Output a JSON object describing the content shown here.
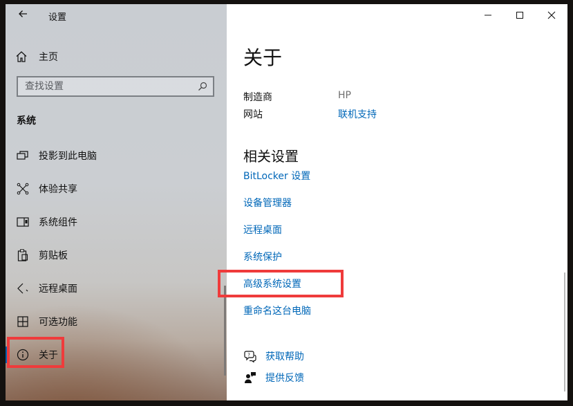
{
  "window": {
    "app_title": "设置",
    "controls": {
      "minimize_icon": "minimize-icon",
      "maximize_icon": "maximize-icon",
      "close_icon": "close-icon"
    }
  },
  "sidebar": {
    "back_icon": "back-arrow-icon",
    "home": {
      "label": "主页",
      "icon": "home-icon"
    },
    "search": {
      "placeholder": "查找设置",
      "value": "",
      "icon": "search-icon"
    },
    "section_title": "系统",
    "items": [
      {
        "label": "投影到此电脑",
        "icon": "projector-icon",
        "active": false
      },
      {
        "label": "体验共享",
        "icon": "share-icon",
        "active": false
      },
      {
        "label": "系统组件",
        "icon": "components-icon",
        "active": false
      },
      {
        "label": "剪贴板",
        "icon": "clipboard-icon",
        "active": false
      },
      {
        "label": "远程桌面",
        "icon": "remote-desktop-icon",
        "active": false
      },
      {
        "label": "可选功能",
        "icon": "grid-icon",
        "active": false
      },
      {
        "label": "关于",
        "icon": "info-icon",
        "active": true
      }
    ]
  },
  "content": {
    "title": "关于",
    "support_info": [
      {
        "key": "制造商",
        "value": "HP",
        "is_link": false
      },
      {
        "key": "网站",
        "value": "联机支持",
        "is_link": true
      }
    ],
    "related_settings": {
      "heading": "相关设置",
      "links": [
        "BitLocker 设置",
        "设备管理器",
        "远程桌面",
        "系统保护",
        "高级系统设置",
        "重命名这台电脑"
      ]
    },
    "help": [
      {
        "label": "获取帮助",
        "icon": "help-chat-icon"
      },
      {
        "label": "提供反馈",
        "icon": "feedback-icon"
      }
    ]
  },
  "colors": {
    "accent": "#0067b8",
    "active_bar": "#0063b1",
    "highlight": "#ef3b3b"
  }
}
